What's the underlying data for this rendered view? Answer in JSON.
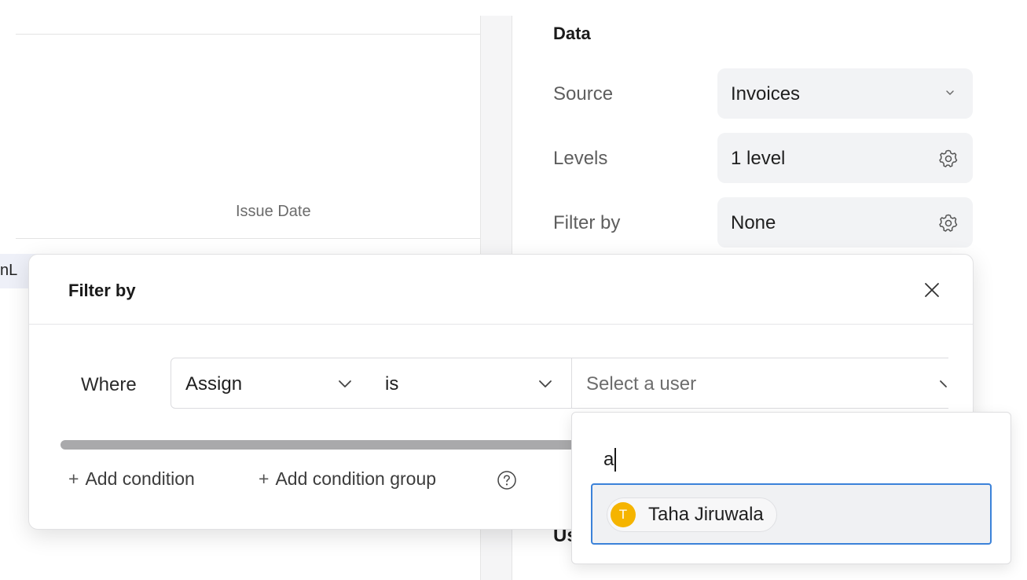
{
  "canvas": {
    "axis_label": "Issue Date",
    "peek_text": "nL"
  },
  "settings": {
    "section_title": "Data",
    "source_label": "Source",
    "source_value": "Invoices",
    "levels_label": "Levels",
    "levels_value": "1 level",
    "filter_label": "Filter by",
    "filter_value": "None",
    "peek_section": "Us"
  },
  "filter_popover": {
    "title": "Filter by",
    "where_label": "Where",
    "field_value": "Assign",
    "operator_value": "is",
    "value_placeholder": "Select a user",
    "add_condition_label": "Add condition",
    "add_condition_group_label": "Add condition group",
    "plus": "+"
  },
  "user_dropdown": {
    "search_value": "a",
    "options": [
      {
        "initial": "T",
        "name": "Taha Jiruwala",
        "avatar_color": "#f5b400"
      }
    ]
  },
  "colors": {
    "accent": "#3b82d9",
    "avatar": "#f5b400",
    "control_bg": "#f2f3f5"
  },
  "icons": [
    "chevron-down-icon",
    "gear-icon",
    "close-icon",
    "help-icon",
    "plus-icon"
  ]
}
